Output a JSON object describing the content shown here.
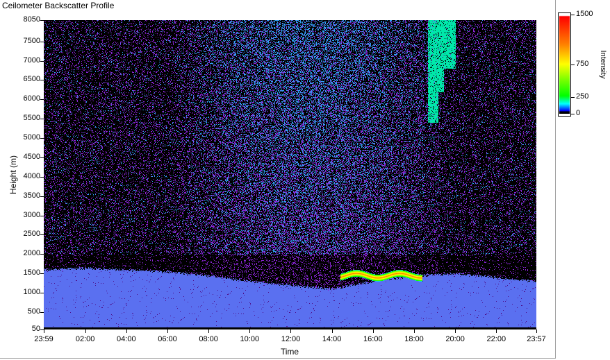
{
  "window": {
    "title": "Ceilometer Backscatter Profile"
  },
  "chart_data": {
    "type": "heatmap",
    "title": "Ceilometer Backscatter Profile",
    "xlabel": "Time",
    "ylabel": "Height (m)",
    "x_tick_labels": [
      "23:59",
      "02:00",
      "04:00",
      "06:00",
      "08:00",
      "10:00",
      "12:00",
      "14:00",
      "16:00",
      "18:00",
      "20:00",
      "22:00",
      "23:57"
    ],
    "x_ticks_hours": [
      -0.0167,
      2,
      4,
      6,
      8,
      10,
      12,
      14,
      16,
      18,
      20,
      22,
      23.95
    ],
    "xlim_hours": [
      -0.0167,
      23.95
    ],
    "y_ticks": [
      50,
      500,
      1000,
      1500,
      2000,
      2500,
      3000,
      3500,
      4000,
      4500,
      5000,
      5500,
      6000,
      6500,
      7000,
      7500,
      8050
    ],
    "ylim": [
      50,
      8050
    ],
    "colorbar": {
      "label": "Intensity",
      "ticks": [
        0,
        250,
        750,
        1500
      ],
      "range": [
        0,
        1500
      ],
      "colors": [
        "#000000",
        "#0000ff",
        "#00ffff",
        "#00ff00",
        "#ffff00",
        "#ff8000",
        "#ff0000",
        "#ffffff"
      ]
    },
    "features": {
      "boundary_layer": {
        "top_m": [
          1600,
          1650,
          1600,
          1550,
          1450,
          1300,
          1200,
          1100,
          1300,
          1450,
          1500,
          1400,
          1300
        ],
        "value": 150,
        "color": "#a000ff"
      },
      "elevated_layer": {
        "start_hour": 14.4,
        "end_hour": 18.4,
        "height_m": 1450,
        "peak_value": 900
      },
      "high_cloud": {
        "start_hour": 18.5,
        "end_hour": 20.3,
        "base_m": 5400,
        "top_m": 8050,
        "value": 220
      },
      "noise_background": {
        "low_value": 60,
        "mid_day_value": 200
      }
    }
  }
}
